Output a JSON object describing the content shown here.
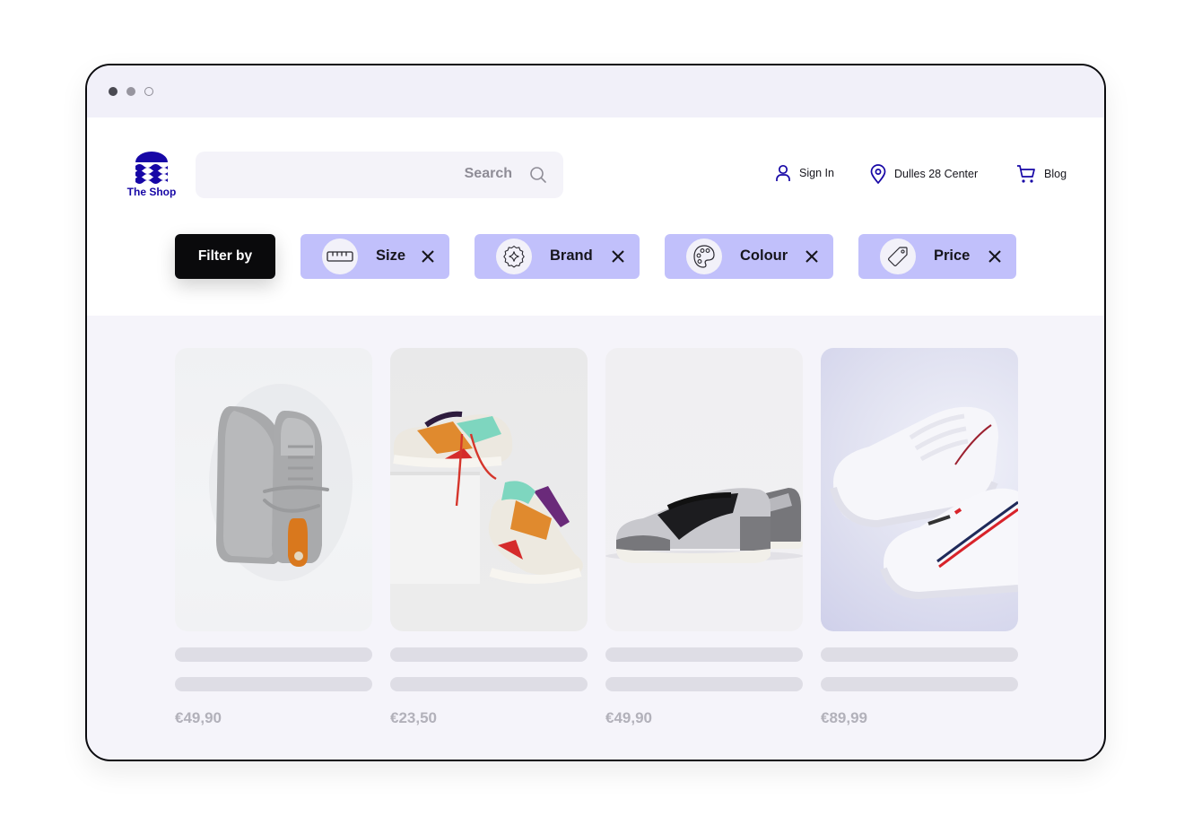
{
  "window": {
    "controls": [
      "close",
      "minimize",
      "maximize"
    ]
  },
  "brand": {
    "name": "The Shop",
    "color": "#1707a6"
  },
  "search": {
    "placeholder": "Search",
    "icon": "search-icon"
  },
  "nav": {
    "sign_in": {
      "label": "Sign In",
      "icon": "user-icon"
    },
    "store": {
      "label": "Dulles 28 Center",
      "icon": "location-pin-icon"
    },
    "blog": {
      "label": "Blog",
      "icon": "cart-icon"
    }
  },
  "filters": {
    "filter_by_label": "Filter by",
    "chip_color": "#c1c0fb",
    "chips": [
      {
        "label": "Size",
        "icon": "ruler-icon"
      },
      {
        "label": "Brand",
        "icon": "badge-star-icon"
      },
      {
        "label": "Colour",
        "icon": "palette-icon"
      },
      {
        "label": "Price",
        "icon": "price-tag-icon"
      }
    ]
  },
  "products": [
    {
      "image": "grey leather low-top sneakers, top view",
      "price": "€49,90"
    },
    {
      "image": "multicolour chunky sneakers on white block",
      "price": "€23,50"
    },
    {
      "image": "black and grey low-top sneaker, side view",
      "price": "€49,90"
    },
    {
      "image": "white sneakers with red and navy stripes",
      "price": "€89,99"
    }
  ]
}
